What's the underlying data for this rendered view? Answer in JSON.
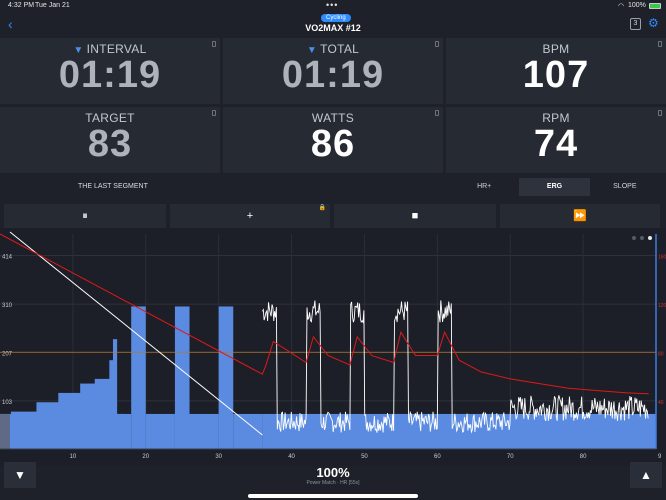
{
  "status": {
    "time": "4:32 PM",
    "date": "Tue Jan 21",
    "battery": "100%"
  },
  "header": {
    "category": "Cycling",
    "title": "VO2MAX #12",
    "lap_count": "3"
  },
  "tiles": [
    {
      "label": "INTERVAL",
      "value": "01:19",
      "caret": true
    },
    {
      "label": "TOTAL",
      "value": "01:19",
      "caret": true
    },
    {
      "label": "BPM",
      "value": "107"
    },
    {
      "label": "TARGET",
      "value": "83"
    },
    {
      "label": "WATTS",
      "value": "86"
    },
    {
      "label": "RPM",
      "value": "74"
    }
  ],
  "segment": {
    "name": "THE LAST SEGMENT",
    "modes": [
      "HR+",
      "ERG",
      "SLOPE"
    ],
    "active_mode": "ERG"
  },
  "controls": {
    "pause": "⏸",
    "add": "+",
    "stop": "■",
    "skip": "⏩"
  },
  "chart_data": {
    "type": "area",
    "x_ticks": [
      10,
      20,
      30,
      40,
      50,
      60,
      70,
      80
    ],
    "x_end_label": "9",
    "x_range": [
      0,
      90
    ],
    "y_left_ticks": [
      "414",
      "310",
      "207",
      "103"
    ],
    "y_right_ticks": [
      "160",
      "120",
      "80",
      "40"
    ],
    "reference_line": {
      "value": 207,
      "color": "#b07a2e"
    },
    "workout_profile": [
      [
        0,
        0
      ],
      [
        2,
        70
      ],
      [
        5,
        80
      ],
      [
        8,
        100
      ],
      [
        11,
        120
      ],
      [
        13,
        140
      ],
      [
        15,
        170
      ],
      [
        16,
        230
      ],
      [
        18,
        0
      ],
      [
        20,
        0
      ],
      [
        24,
        0
      ],
      [
        26,
        0
      ],
      [
        30,
        0
      ],
      [
        32,
        0
      ],
      [
        36,
        0
      ]
    ],
    "colors": {
      "target": "#5b8be0",
      "power": "#ffffff",
      "heart_rate": "#e01818",
      "time_cursor": "#3a7fe0"
    }
  },
  "footer": {
    "value": "100%",
    "caption": "Power Match · HR [55s]"
  }
}
